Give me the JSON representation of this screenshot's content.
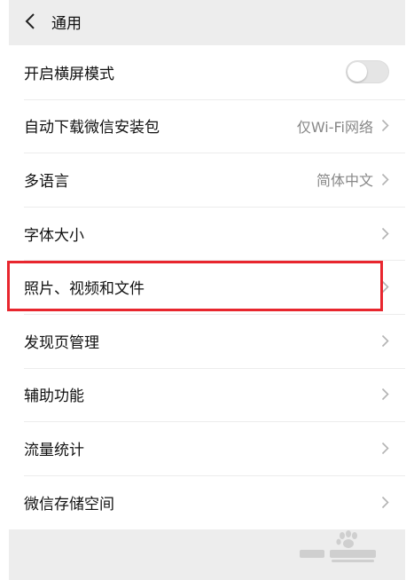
{
  "header": {
    "title": "通用",
    "back_icon": "chevron-left-icon"
  },
  "settings": {
    "landscape": {
      "label": "开启横屏模式",
      "toggle_on": false
    },
    "auto_download": {
      "label": "自动下载微信安装包",
      "value": "仅Wi-Fi网络"
    },
    "language": {
      "label": "多语言",
      "value": "简体中文"
    },
    "font_size": {
      "label": "字体大小"
    },
    "media": {
      "label": "照片、视频和文件"
    },
    "discover": {
      "label": "发现页管理"
    },
    "accessibility": {
      "label": "辅助功能"
    },
    "traffic": {
      "label": "流量统计"
    },
    "storage": {
      "label": "微信存储空间"
    }
  },
  "highlight": {
    "color": "#e8262e",
    "target": "media"
  },
  "watermark": {
    "type": "logo",
    "icon": "baidu-paw-icon",
    "text": "Baidu 经验",
    "subtext": "jingyan.baidu.com"
  }
}
